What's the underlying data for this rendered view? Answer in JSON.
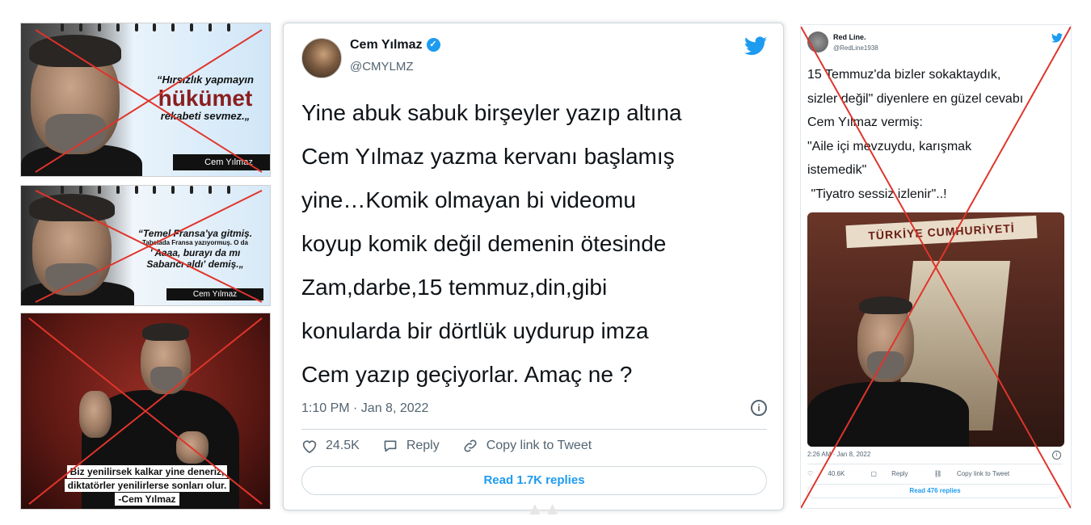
{
  "left_images": [
    {
      "quote_line1": "“Hırsızlık yapmayın",
      "quote_big": "hükümet",
      "quote_line3": "rekabeti sevmez.„",
      "signature": "Cem Yılmaz"
    },
    {
      "quote_line1": "“Temel Fransa'ya gitmiş.",
      "quote_small": "Tabelada Fransa yazıyormuş. O da",
      "quote_line3": "' Aaaa, burayı da mı",
      "quote_line4": "Sabancı aldı' demiş.„",
      "signature": "Cem Yılmaz"
    },
    {
      "caption_line1": "Biz yenilirsek kalkar yine deneriz,",
      "caption_line2": "diktatörler yenilirlerse sonları olur.",
      "caption_line3": "-Cem Yılmaz"
    }
  ],
  "main_tweet": {
    "author_name": "Cem Yılmaz",
    "author_handle": "@CMYLMZ",
    "lines": [
      "Yine abuk sabuk birşeyler yazıp altına",
      "Cem Yılmaz yazma kervanı başlamış",
      "yine…Komik olmayan bi videomu",
      "koyup komik değil demenin ötesinde",
      "Zam,darbe,15 temmuz,din,gibi",
      "konularda bir dörtlük uydurup imza",
      "Cem yazıp geçiyorlar. Amaç ne ?"
    ],
    "timestamp": "1:10 PM · Jan 8, 2022",
    "likes": "24.5K",
    "reply_label": "Reply",
    "copy_label": "Copy link to Tweet",
    "read_replies": "Read 1.7K replies",
    "icons": {
      "verified": "verified-badge-icon",
      "bird": "twitter-bird-icon",
      "info": "info-icon",
      "heart": "heart-icon",
      "reply": "reply-icon",
      "link": "link-icon"
    },
    "accent_color": "#1d9bf0"
  },
  "side_tweet": {
    "author_name": "Red Line.",
    "author_handle": "@RedLine1938",
    "lines": [
      "15 Temmuz'da bizler sokaktaydık,",
      "sizler değil\" diyenlere en güzel cevabı",
      "Cem Yılmaz vermiş:",
      "\"Aile içi mevzuydu, karışmak",
      "istemedik\"",
      " \"Tiyatro sessiz izlenir\"..!"
    ],
    "photo_banner": "TÜRKİYE CUMHURİYETİ",
    "timestamp": "2:26 AM · Jan 8, 2022",
    "likes": "40.6K",
    "reply_label": "Reply",
    "copy_label": "Copy link to Tweet",
    "read_replies": "Read 476 replies"
  },
  "marks": {
    "cross_color": "#e0342a"
  }
}
